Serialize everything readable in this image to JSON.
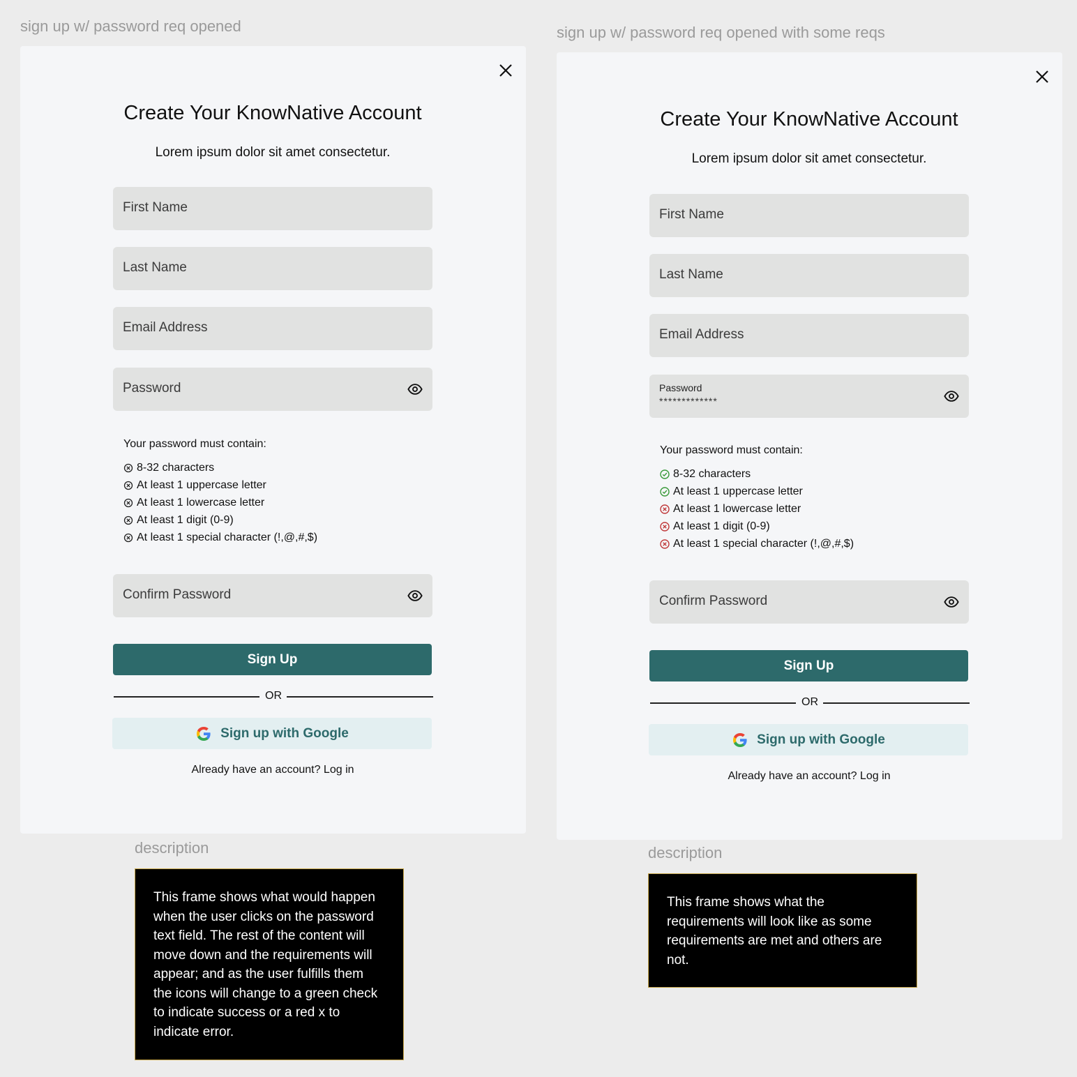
{
  "frames": [
    {
      "label": "sign up w/ password req opened",
      "title": "Create Your KnowNative Account",
      "subtitle": "Lorem ipsum dolor sit amet consectetur.",
      "fields": {
        "first_name": "First Name",
        "last_name": "Last Name",
        "email": "Email Address",
        "password_placeholder": "Password",
        "confirm_password": "Confirm Password"
      },
      "requirements_title": "Your password must contain:",
      "requirements": [
        {
          "text": "8-32 characters",
          "status": "neutral"
        },
        {
          "text": "At least 1 uppercase letter",
          "status": "neutral"
        },
        {
          "text": "At least 1 lowercase letter",
          "status": "neutral"
        },
        {
          "text": "At least 1 digit (0-9)",
          "status": "neutral"
        },
        {
          "text": "At least 1 special character (!,@,#,$)",
          "status": "neutral"
        }
      ],
      "sign_up": "Sign Up",
      "or": "OR",
      "google": "Sign up with Google",
      "login_prompt": "Already have an account? Log in",
      "description_label": "description",
      "description": "This frame shows what would happen when the user clicks on the password text field. The rest of the content will move down and the requirements will appear; and as the user fulfills them the icons will change to a green check to indicate success or a red x to indicate error."
    },
    {
      "label": "sign up w/ password req opened with some reqs",
      "title": "Create Your KnowNative Account",
      "subtitle": "Lorem ipsum dolor sit amet consectetur.",
      "fields": {
        "first_name": "First Name",
        "last_name": "Last Name",
        "email": "Email Address",
        "password_label": "Password",
        "password_value": "*************",
        "confirm_password": "Confirm Password"
      },
      "requirements_title": "Your password must contain:",
      "requirements": [
        {
          "text": "8-32 characters",
          "status": "success"
        },
        {
          "text": "At least 1 uppercase letter",
          "status": "success"
        },
        {
          "text": "At least 1 lowercase letter",
          "status": "error"
        },
        {
          "text": "At least 1 digit (0-9)",
          "status": "error"
        },
        {
          "text": "At least 1 special character (!,@,#,$)",
          "status": "error"
        }
      ],
      "sign_up": "Sign Up",
      "or": "OR",
      "google": "Sign up with Google",
      "login_prompt": "Already have an account? Log in",
      "description_label": "description",
      "description": "This frame shows what the requirements will look like as some requirements are met and others are not."
    }
  ],
  "colors": {
    "primary": "#2d6a6b",
    "success": "#3a9a3a",
    "error": "#c0393b",
    "neutral": "#222222"
  }
}
